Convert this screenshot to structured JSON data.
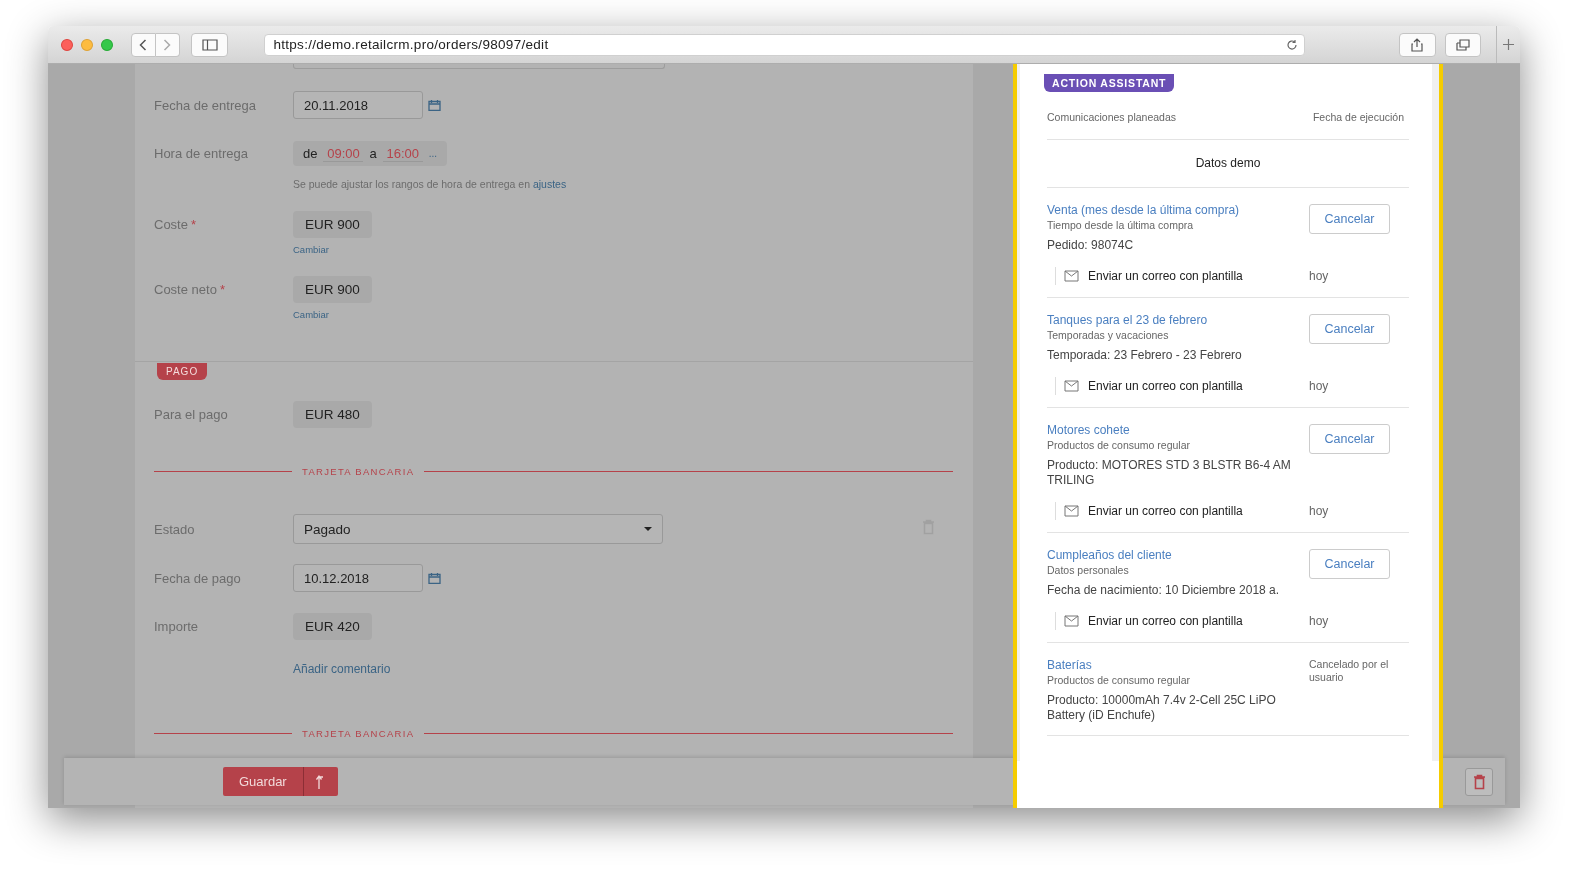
{
  "browser": {
    "url": "https://demo.retailcrm.pro/orders/98097/edit"
  },
  "delivery": {
    "date_label": "Fecha de entrega",
    "date": "20.11.2018",
    "time_label": "Hora de entrega",
    "from_word": "de",
    "from": "09:00",
    "to_word": "a",
    "to": "16:00",
    "more": "...",
    "hint": "Se puede ajustar los rangos de hora de entrega en",
    "hint_link": "ajustes"
  },
  "costs": [
    {
      "label": "Coste",
      "mark": "*",
      "value": "EUR 900",
      "action": "Cambiar"
    },
    {
      "label": "Coste neto",
      "mark": "*",
      "value": "EUR 900",
      "action": "Cambiar"
    }
  ],
  "payment": {
    "badge": "PAGO",
    "to_pay_label": "Para el pago",
    "to_pay": "EUR 480",
    "divider": "TARJETA BANCARIA",
    "status_label": "Estado",
    "status": "Pagado",
    "date_label": "Fecha de pago",
    "date": "10.12.2018",
    "amount_label": "Importe",
    "amount": "EUR 420",
    "comment_link": "Añadir comentario",
    "next_divider": "TARJETA BANCARIA"
  },
  "footer": {
    "save": "Guardar"
  },
  "assistant": {
    "badge": "ACTION ASSISTANT",
    "col_1": "Comunicaciones planeadas",
    "col_2": "Fecha de ejecución",
    "demo": "Datos demo",
    "items": [
      {
        "kind": "scheduled",
        "title": "Venta (mes desde la última compra)",
        "category": "Tiempo desde la última compra",
        "detail": "Pedido: 98074C",
        "button": "Cancelar",
        "action": "Enviar un correo con plantilla",
        "when": "hoy"
      },
      {
        "kind": "scheduled",
        "title": "Tanques para el 23 de febrero",
        "category": "Temporadas y vacaciones",
        "detail": "Temporada: 23 Febrero - 23 Febrero",
        "button": "Cancelar",
        "action": "Enviar un correo con plantilla",
        "when": "hoy"
      },
      {
        "kind": "scheduled",
        "title": "Motores cohete",
        "category": "Productos de consumo regular",
        "detail": "Producto: MOTORES STD 3 BLSTR B6-4 AM TRILING",
        "button": "Cancelar",
        "action": "Enviar un correo con plantilla",
        "when": "hoy"
      },
      {
        "kind": "scheduled",
        "title": "Cumpleaños del cliente",
        "category": "Datos personales",
        "detail": "Fecha de nacimiento: 10 Diciembre 2018 a.",
        "button": "Cancelar",
        "action": "Enviar un correo con plantilla",
        "when": "hoy"
      },
      {
        "kind": "cancelled",
        "title": "Baterías",
        "category": "Productos de consumo regular",
        "detail": "Producto: 10000mAh 7.4v 2-Cell 25C LiPO Battery (iD Enchufe)",
        "status": "Cancelado por el usuario"
      }
    ]
  }
}
